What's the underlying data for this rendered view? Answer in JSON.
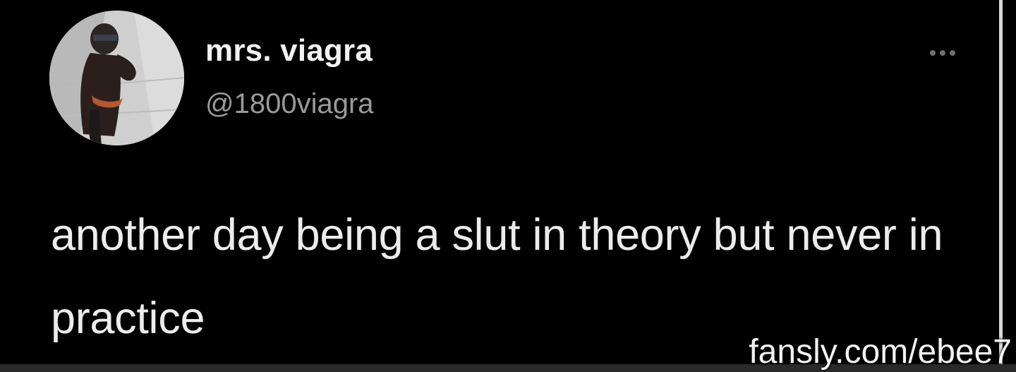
{
  "tweet": {
    "author": {
      "display_name": "mrs. viagra",
      "handle": "@1800viagra",
      "avatar_icon": "profile-photo"
    },
    "text": "another day being a slut in theory but never in practice",
    "more_icon": "more-horizontal-icon"
  },
  "watermark": {
    "text": "fansly.com/ebee7"
  },
  "colors": {
    "background": "#000000",
    "name": "#f2f2f2",
    "handle": "#9a9a9a",
    "text": "#ececec"
  }
}
